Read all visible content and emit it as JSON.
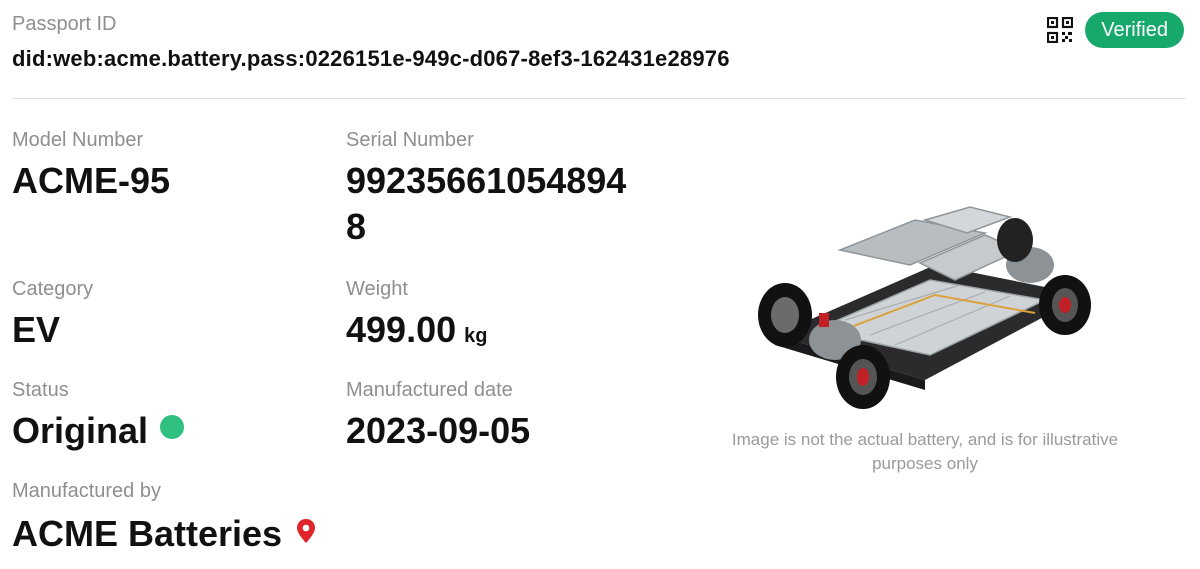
{
  "header": {
    "passport_label": "Passport ID",
    "passport_id": "did:web:acme.battery.pass:0226151e-949c-d067-8ef3-162431e28976",
    "qr_icon": "qr-code-icon",
    "badge": "Verified",
    "badge_color": "#17a86b"
  },
  "fields": {
    "model": {
      "label": "Model Number",
      "value": "ACME-95"
    },
    "serial": {
      "label": "Serial Number",
      "value": "992356610548948"
    },
    "category": {
      "label": "Category",
      "value": "EV"
    },
    "weight": {
      "label": "Weight",
      "value": "499.00",
      "unit": "kg"
    },
    "status": {
      "label": "Status",
      "value": "Original",
      "dot_color": "#2fbf7f"
    },
    "manufactured_date": {
      "label": "Manufactured date",
      "value": "2023-09-05"
    },
    "manufactured_by": {
      "label": "Manufactured by",
      "value": "ACME Batteries",
      "icon": "location-pin-icon"
    }
  },
  "image": {
    "icon": "ev-chassis-image",
    "caption": "Image is not the actual battery, and is for illustrative purposes only"
  }
}
